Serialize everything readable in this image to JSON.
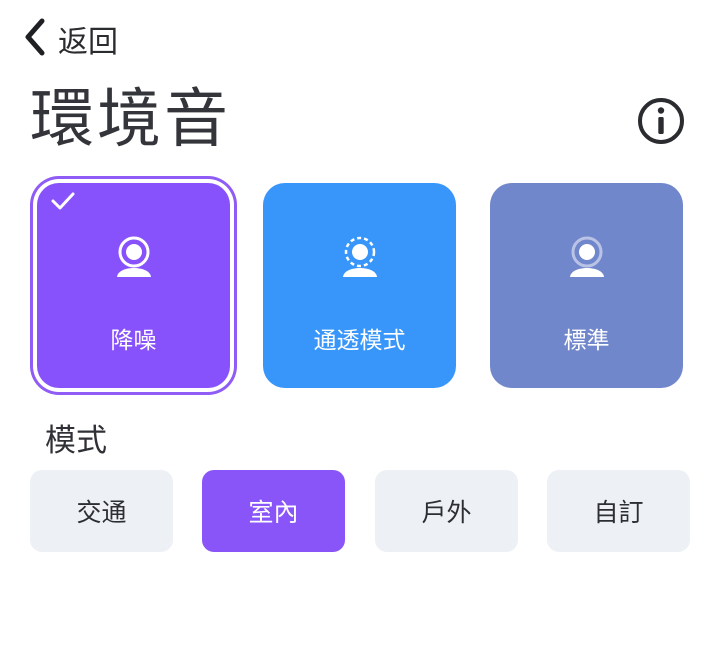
{
  "nav": {
    "back_label": "返回"
  },
  "page": {
    "title": "環境音"
  },
  "sound_modes": [
    {
      "label": "降噪",
      "color": "#8751fb",
      "selected": true,
      "icon": "person-ring-icon"
    },
    {
      "label": "通透模式",
      "color": "#3896fb",
      "selected": false,
      "icon": "person-dashed-ring-icon"
    },
    {
      "label": "標準",
      "color": "#7187cb",
      "selected": false,
      "icon": "person-faint-ring-icon"
    }
  ],
  "mode_section": {
    "title": "模式",
    "options": [
      {
        "label": "交通",
        "selected": false
      },
      {
        "label": "室內",
        "selected": true
      },
      {
        "label": "戶外",
        "selected": false
      },
      {
        "label": "自訂",
        "selected": false
      }
    ]
  },
  "colors": {
    "selected_outline": "#8f5cf5",
    "option_active": "#8a55f8",
    "option_inactive": "#edf1f5"
  }
}
